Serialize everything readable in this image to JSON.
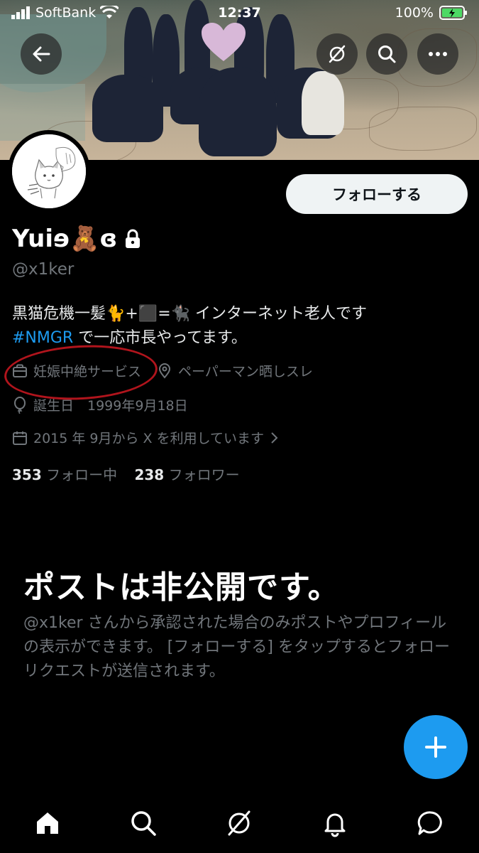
{
  "status_bar": {
    "carrier": "SoftBank",
    "time": "12:37",
    "battery": "100%"
  },
  "profile": {
    "name": "Yuiɘ🧸ɞ",
    "handle": "@x1ker",
    "bio_line1": "黒猫危機一髪🐈+⬛=🐈‍⬛ インターネット老人です",
    "bio_hashtag": "#NMGR",
    "bio_line2_rest": " で一応市長やってます。",
    "category": "妊娠中絶サービス",
    "location": "ペーパーマン晒しスレ",
    "birthday": "誕生日　1999年9月18日",
    "joined": "2015 年 9月から X を利用しています",
    "following_count": "353",
    "following_label": "フォロー中",
    "followers_count": "238",
    "followers_label": "フォロワー"
  },
  "actions": {
    "follow_label": "フォローする"
  },
  "private_notice": {
    "title": "ポストは非公開です。",
    "description": "@x1ker さんから承認された場合のみポストやプロフィールの表示ができます。 [フォローする] をタップするとフォローリクエストが送信されます。"
  },
  "colors": {
    "accent": "#1d9bf0",
    "annotation": "#b0141c"
  }
}
